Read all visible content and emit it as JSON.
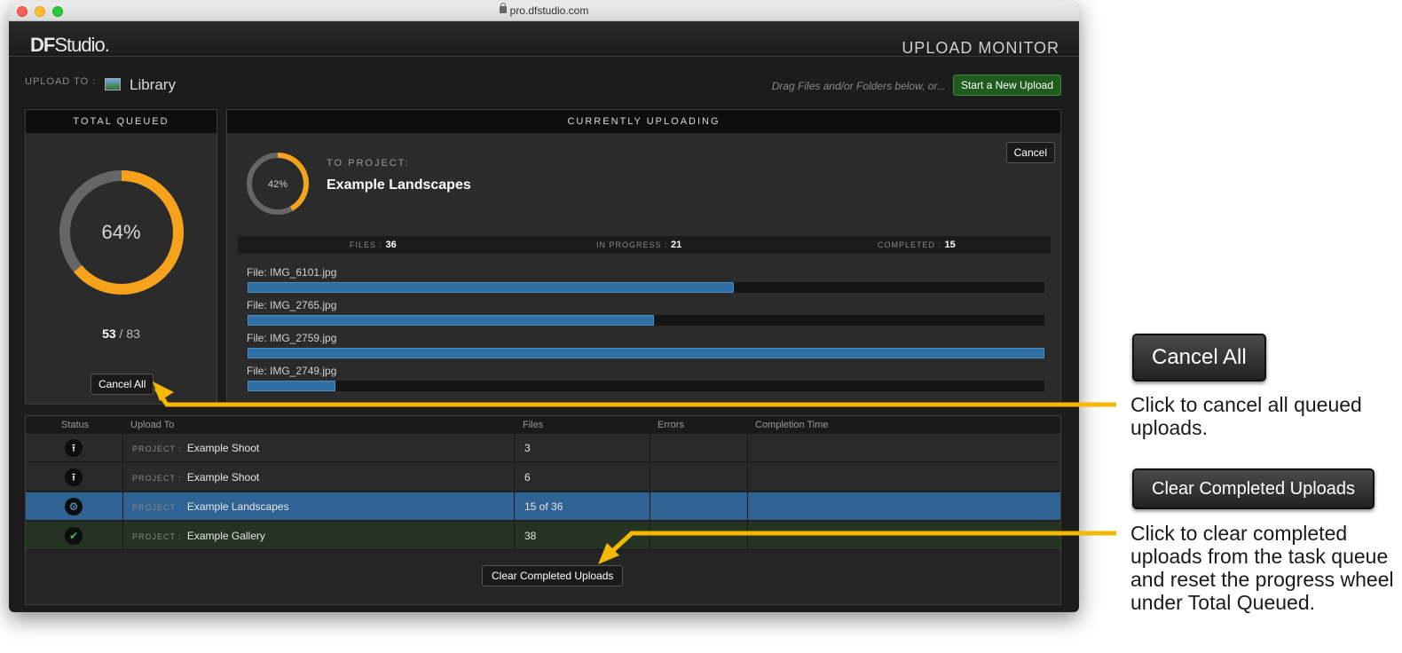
{
  "browser": {
    "url": "pro.dfstudio.com"
  },
  "app": {
    "logo_bold": "DF",
    "logo_rest": "Studio.",
    "page_title": "UPLOAD MONITOR"
  },
  "upload_to": {
    "label": "UPLOAD TO :",
    "destination": "Library"
  },
  "actions": {
    "drag_hint": "Drag Files and/or Folders below, or...",
    "start_button": "Start a New Upload"
  },
  "total_queued": {
    "title": "TOTAL QUEUED",
    "percent_label": "64%",
    "progress": 0.64,
    "done": "53",
    "total": "/ 83",
    "cancel_all_label": "Cancel All"
  },
  "current": {
    "title": "CURRENTLY UPLOADING",
    "percent_label": "42%",
    "progress": 0.42,
    "to_project_label": "TO PROJECT:",
    "project_name": "Example Landscapes",
    "cancel_label": "Cancel",
    "stats": {
      "files_label": "FILES :",
      "files_value": "36",
      "in_progress_label": "IN PROGRESS :",
      "in_progress_value": "21",
      "completed_label": "COMPLETED :",
      "completed_value": "15"
    },
    "files": [
      {
        "label": "File: IMG_6101.jpg",
        "progress": 0.61
      },
      {
        "label": "File: IMG_2765.jpg",
        "progress": 0.51
      },
      {
        "label": "File: IMG_2759.jpg",
        "progress": 1.0
      },
      {
        "label": "File: IMG_2749.jpg",
        "progress": 0.11
      }
    ]
  },
  "table": {
    "headers": {
      "status": "Status",
      "upload_to": "Upload To",
      "files": "Files",
      "errors": "Errors",
      "completion_time": "Completion Time"
    },
    "rows": [
      {
        "status": "queued",
        "icon": "upload-icon",
        "tag": "PROJECT :",
        "project": "Example Shoot",
        "files": "3",
        "errors": "",
        "completion_time": ""
      },
      {
        "status": "queued",
        "icon": "upload-icon",
        "tag": "PROJECT :",
        "project": "Example Shoot",
        "files": "6",
        "errors": "",
        "completion_time": ""
      },
      {
        "status": "uploading",
        "icon": "gear-icon",
        "tag": "PROJECT :",
        "project": "Example Landscapes",
        "files": "15 of 36",
        "errors": "",
        "completion_time": ""
      },
      {
        "status": "completed",
        "icon": "check-icon",
        "tag": "PROJECT :",
        "project": "Example Gallery",
        "files": "38",
        "errors": "",
        "completion_time": ""
      }
    ],
    "clear_label": "Clear Completed Uploads"
  },
  "callouts": {
    "cancel_all_button": "Cancel All",
    "cancel_all_text": "Click to cancel all queued uploads.",
    "clear_button": "Clear Completed Uploads",
    "clear_text": "Click to clear completed uploads from the task queue and reset the progress wheel under Total Queued."
  },
  "colors": {
    "accent": "#f7a21b",
    "track": "#666666",
    "row_selected": "#2f6394",
    "row_completed": "#243322",
    "arrow": "#f5b800",
    "progress_fill": "#2f6fa3"
  }
}
